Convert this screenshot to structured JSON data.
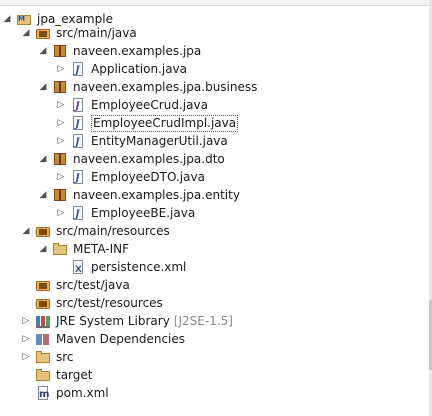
{
  "tree": {
    "project": "jpa_example",
    "src_main_java": "src/main/java",
    "pkg_jpa": "naveen.examples.jpa",
    "application_java": "Application.java",
    "pkg_business": "naveen.examples.jpa.business",
    "employee_crud": "EmployeeCrud.java",
    "employee_crud_impl": "EmployeeCrudImpl.java",
    "entity_manager_util": "EntityManagerUtil.java",
    "pkg_dto": "naveen.examples.jpa.dto",
    "employee_dto": "EmployeeDTO.java",
    "pkg_entity": "naveen.examples.jpa.entity",
    "employee_be": "EmployeeBE.java",
    "src_main_resources": "src/main/resources",
    "meta_inf": "META-INF",
    "persistence_xml": "persistence.xml",
    "src_test_java": "src/test/java",
    "src_test_resources": "src/test/resources",
    "jre_library": "JRE System Library",
    "jre_version": "[J2SE-1.5]",
    "maven_deps": "Maven Dependencies",
    "src": "src",
    "target": "target",
    "pom_xml": "pom.xml"
  },
  "arrows": {
    "expanded": "◢",
    "collapsed": "▷"
  }
}
